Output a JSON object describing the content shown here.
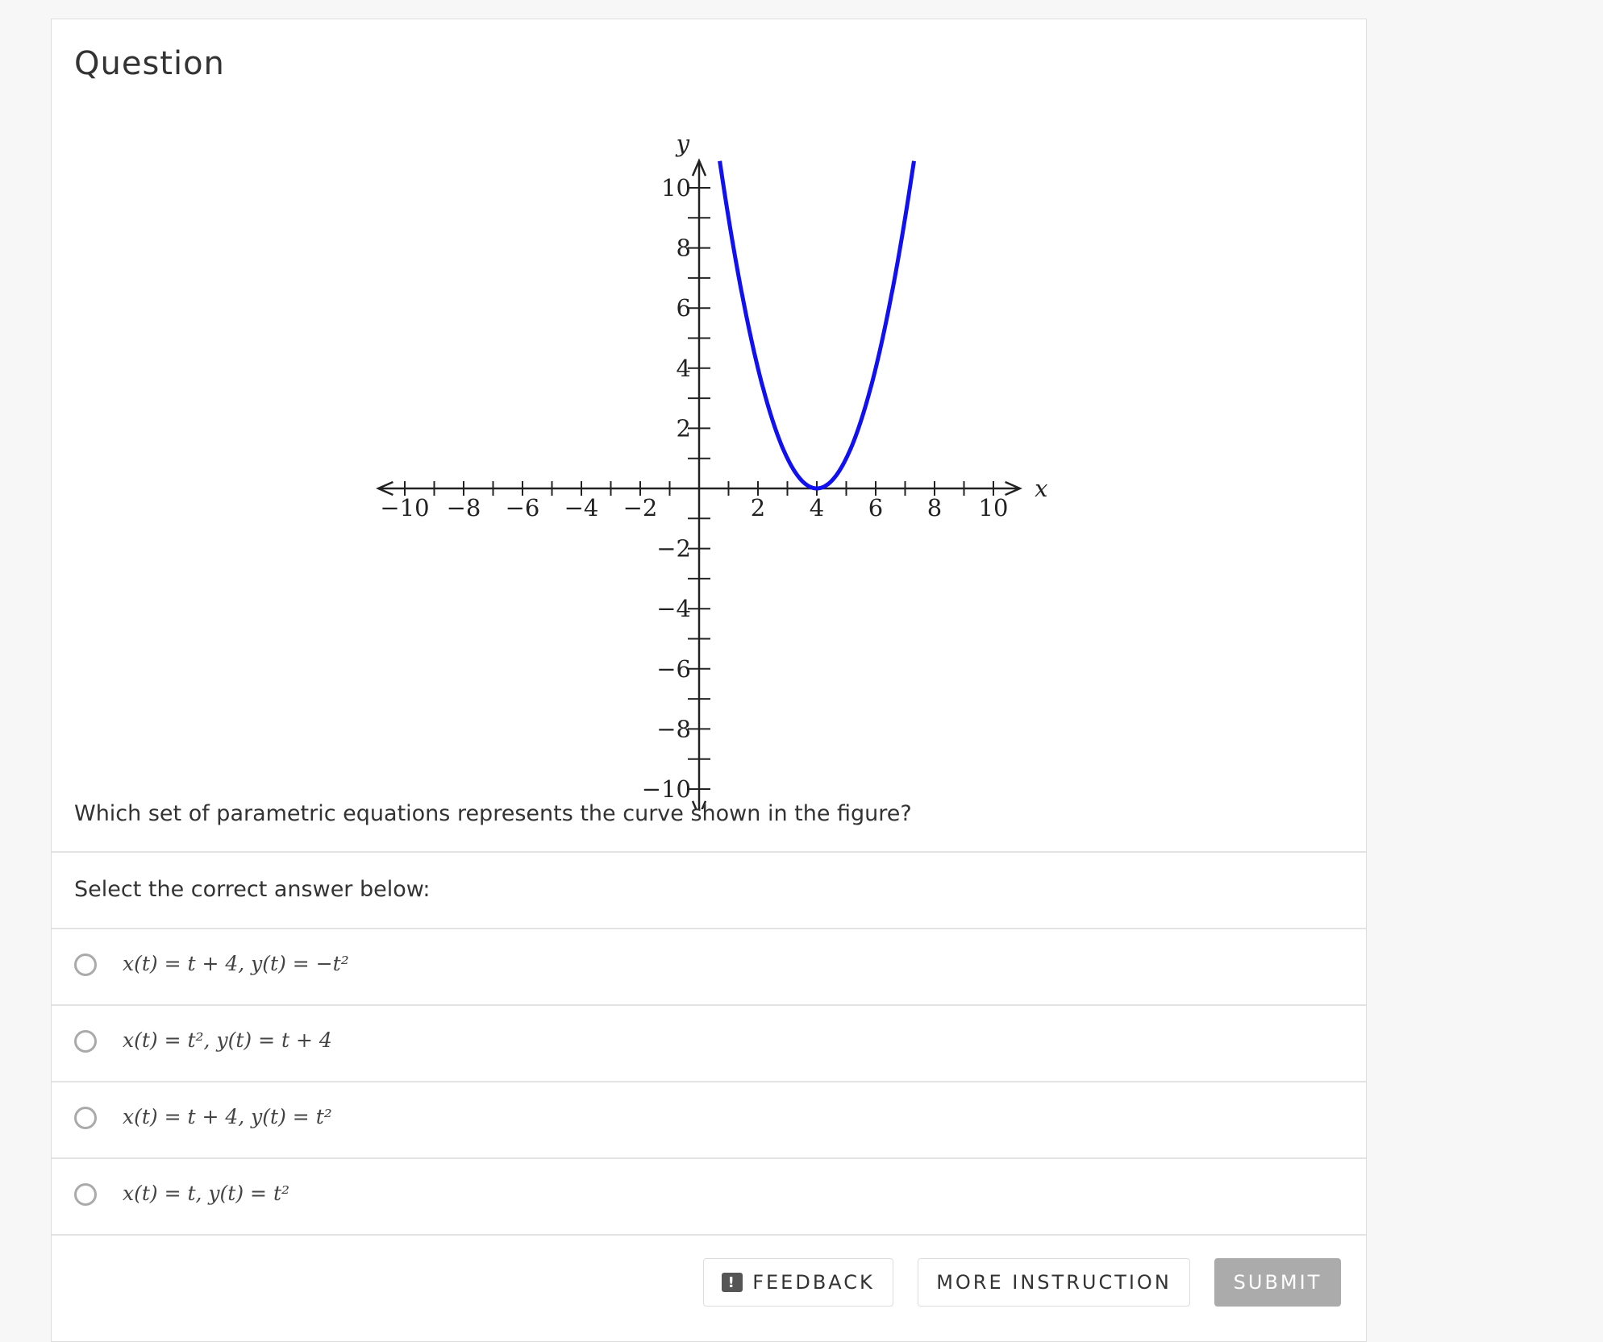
{
  "question": {
    "title": "Question",
    "prompt": "Which set of parametric equations represents the curve shown in the figure?",
    "select_label": "Select the correct answer below:",
    "options": [
      {
        "label": "x(t) = t + 4, y(t) = −t²"
      },
      {
        "label": "x(t) = t², y(t) = t + 4"
      },
      {
        "label": "x(t) = t + 4, y(t) = t²"
      },
      {
        "label": "x(t) = t, y(t) = t²"
      }
    ]
  },
  "buttons": {
    "feedback": "FEEDBACK",
    "more_instruction": "MORE INSTRUCTION",
    "submit": "SUBMIT"
  },
  "icons": {
    "feedback": "exclamation-speech-bubble-icon",
    "feedback_glyph": "!"
  },
  "chart_data": {
    "type": "line",
    "xlabel": "x",
    "ylabel": "y",
    "xlim": [
      -10,
      10
    ],
    "ylim": [
      -10,
      10
    ],
    "x_ticks": [
      -10,
      -8,
      -6,
      -4,
      -2,
      2,
      4,
      6,
      8,
      10
    ],
    "y_ticks": [
      10,
      8,
      6,
      4,
      2,
      -2,
      -4,
      -6,
      -8,
      -10
    ],
    "x_tick_labels": [
      "−10",
      "−8",
      "−6",
      "−4",
      "−2",
      "2",
      "4",
      "6",
      "8",
      "10"
    ],
    "y_tick_labels": [
      "10",
      "8",
      "6",
      "4",
      "2",
      "−2",
      "−4",
      "−6",
      "−8",
      "−10"
    ],
    "curve": {
      "equation": "y = (x − 4)²",
      "x_range": [
        0.7,
        7.3
      ],
      "vertex": [
        4,
        0
      ],
      "color": "#1010f0"
    }
  }
}
